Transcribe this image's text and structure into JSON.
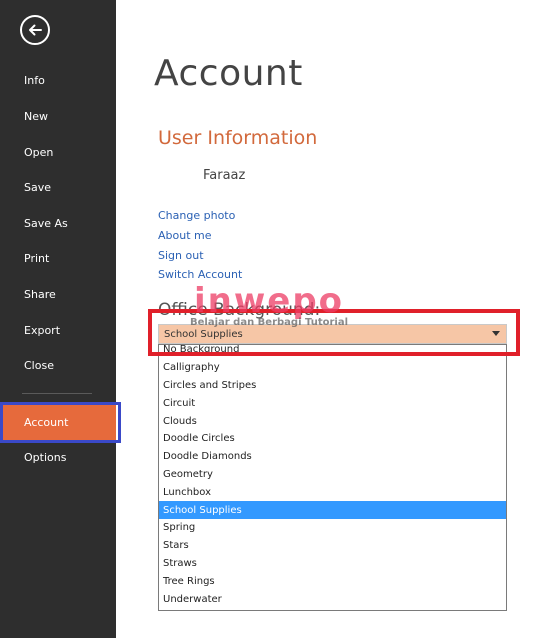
{
  "sidebar": {
    "back_icon": "back-arrow-icon",
    "items": [
      {
        "label": "Info"
      },
      {
        "label": "New"
      },
      {
        "label": "Open"
      },
      {
        "label": "Save"
      },
      {
        "label": "Save As"
      },
      {
        "label": "Print"
      },
      {
        "label": "Share"
      },
      {
        "label": "Export"
      },
      {
        "label": "Close"
      },
      {
        "label": "Account",
        "active": true
      },
      {
        "label": "Options"
      }
    ],
    "background_color": "#2e2e2e",
    "active_color": "#e66a3c"
  },
  "main": {
    "title": "Account",
    "user_info": {
      "heading": "User Information",
      "name": "Faraaz",
      "links": [
        "Change photo",
        "About me",
        "Sign out",
        "Switch Account"
      ]
    },
    "office_background": {
      "label": "Office Background:",
      "selected": "School Supplies",
      "options": [
        "No Background",
        "Calligraphy",
        "Circles and Stripes",
        "Circuit",
        "Clouds",
        "Doodle Circles",
        "Doodle Diamonds",
        "Geometry",
        "Lunchbox",
        "School Supplies",
        "Spring",
        "Stars",
        "Straws",
        "Tree Rings",
        "Underwater"
      ],
      "highlighted_option": "School Supplies"
    }
  },
  "watermark": {
    "main": "inwepo",
    "sub": "Belajar dan Berbagi Tutorial"
  },
  "colors": {
    "accent_orange": "#d2693c",
    "link_blue": "#2b61b4",
    "selection_blue": "#3399ff",
    "annotation_red": "#e0202a",
    "annotation_blue": "#3a49c8"
  }
}
